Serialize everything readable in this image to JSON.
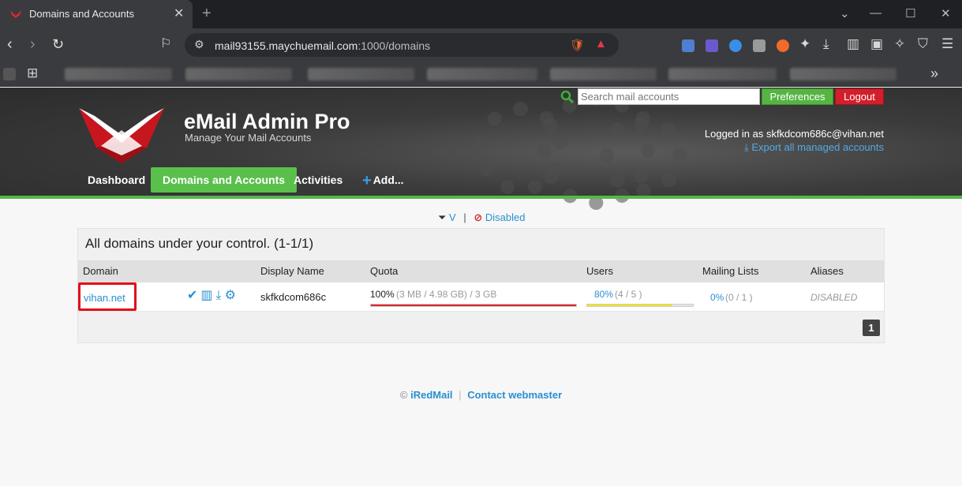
{
  "browser": {
    "tab_title": "Domains and Accounts",
    "url_host": "mail93155.maychuemail.com",
    "url_path": ":1000/domains"
  },
  "header": {
    "brand": "eMail Admin Pro",
    "tagline": "Manage Your Mail Accounts",
    "search_placeholder": "Search mail accounts",
    "preferences_label": "Preferences",
    "logout_label": "Logout",
    "logged_in_text": "Logged in as skfkdcom686c@vihan.net",
    "export_label": "Export all managed accounts"
  },
  "nav": {
    "items": [
      {
        "label": "Dashboard"
      },
      {
        "label": "Domains and Accounts"
      },
      {
        "label": "Activities"
      },
      {
        "label": "Add..."
      }
    ]
  },
  "filter": {
    "v_label": "V",
    "separator": "|",
    "disabled_label": "Disabled"
  },
  "panel": {
    "title": "All domains under your control. (1-1/1)",
    "columns": [
      "Domain",
      "Display Name",
      "Quota",
      "Users",
      "Mailing Lists",
      "Aliases"
    ],
    "row": {
      "domain": "vihan.net",
      "display_name": "skfkdcom686c",
      "quota_pct": "100%",
      "quota_detail": "(3 MB / 4.98 GB) / 3 GB",
      "quota_fraction": 1.0,
      "users_pct": "80%",
      "users_detail": "(4 / 5 )",
      "users_fraction": 0.8,
      "mailing_pct": "0%",
      "mailing_detail": "(0 / 1 )",
      "aliases": "DISABLED"
    },
    "page": "1"
  },
  "footer": {
    "copyright": "©",
    "iredmail": "iRedMail",
    "separator": "|",
    "contact": "Contact webmaster"
  },
  "colors": {
    "accent_green": "#5ac04c",
    "link_blue": "#2a8fd1",
    "logout_red": "#d21f2b",
    "quota_bar": "#e0262b",
    "users_bar": "#f2e51a"
  }
}
